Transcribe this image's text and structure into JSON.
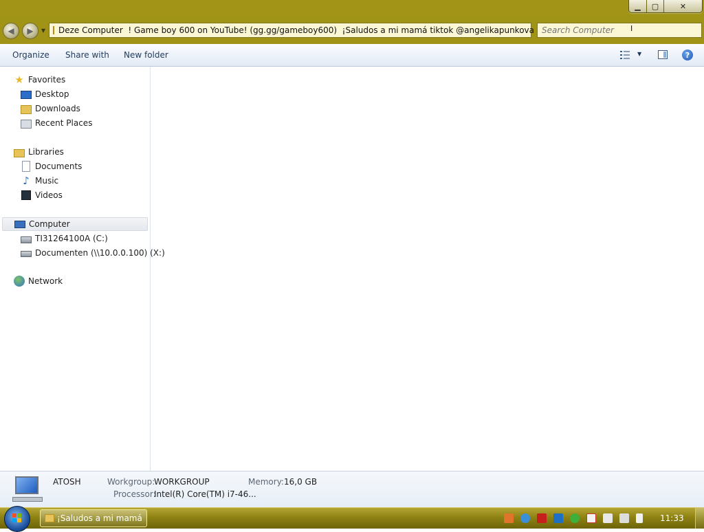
{
  "window": {
    "caption_buttons": {
      "minimize": "▁",
      "maximize": "▢",
      "close": "✕"
    }
  },
  "nav": {
    "back_icon": "back-arrow-icon",
    "forward_icon": "forward-arrow-icon",
    "address": "Deze Computer  ! Game boy 600 on YouTube! (gg.gg/gameboy600)  ¡Saludos a mi mamá tiktok @angelikapunkova",
    "search_placeholder": "Search Computer"
  },
  "toolbar": {
    "organize": "Organize",
    "share_with": "Share with",
    "new_folder": "New folder",
    "help": "?"
  },
  "sidebar": {
    "favorites": "Favorites",
    "desktop": "Desktop",
    "downloads": "Downloads",
    "recent_places": "Recent Places",
    "libraries": "Libraries",
    "documents": "Documents",
    "music": "Music",
    "videos": "Videos",
    "computer": "Computer",
    "drive_c": "TI31264100A (C:)",
    "drive_x": "Documenten (\\\\10.0.0.100) (X:)",
    "network": "Network"
  },
  "details": {
    "computer_name": "ATOSH",
    "workgroup_label": "Workgroup:",
    "workgroup_value": "WORKGROUP",
    "memory_label": "Memory:",
    "memory_value": "16,0 GB",
    "processor_label": "Processor:",
    "processor_value": "Intel(R) Core(TM) i7-46..."
  },
  "taskbar": {
    "task_label": "¡Saludos a mi mamá",
    "clock": "11:33",
    "tray_icons": [
      "java-icon",
      "network-globe-icon",
      "acrobat-icon",
      "outlook-icon",
      "security-check-icon",
      "flag-icon",
      "sync-icon",
      "network-icon",
      "volume-icon"
    ]
  },
  "colors": {
    "theme_olive": "#9c8f14",
    "toolbar_text": "#1e395b",
    "selection": "#e5e8ee"
  }
}
